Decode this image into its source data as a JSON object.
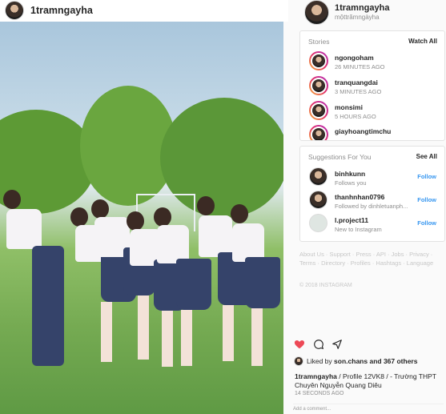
{
  "post": {
    "username": "1tramngayha",
    "actions": {
      "like_icon": "heart-icon",
      "comment_icon": "comment-icon",
      "share_icon": "share-icon",
      "like_color": "#ed4956"
    },
    "liked_by_prefix": "Liked by",
    "liked_by_user": "son.chans",
    "liked_by_suffix": "and 367 others",
    "caption_user": "1tramngayha",
    "caption_text": "/ Profile 12VK8 / - Trường THPT Chuyên Nguyễn Quang Diêu",
    "time": "14 SECONDS AGO",
    "add_comment_placeholder": "Add a comment..."
  },
  "profile": {
    "username": "1tramngayha",
    "fullname": "mộttrămngàyha"
  },
  "stories": {
    "title": "Stories",
    "watch_all": "Watch All",
    "items": [
      {
        "name": "ngongoham",
        "time": "26 MINUTES AGO"
      },
      {
        "name": "tranquangdai",
        "time": "3 MINUTES AGO"
      },
      {
        "name": "monsimi",
        "time": "5 HOURS AGO"
      },
      {
        "name": "giayhoangtimchu",
        "time": ""
      }
    ]
  },
  "suggestions": {
    "title": "Suggestions For You",
    "see_all": "See All",
    "items": [
      {
        "name": "binhkunn",
        "sub": "Follows you",
        "action": "Follow"
      },
      {
        "name": "thanhnhan0796",
        "sub": "Followed by dinhletuanph...",
        "action": "Follow"
      },
      {
        "name": "l.project11",
        "sub": "New to Instagram",
        "action": "Follow"
      }
    ]
  },
  "footer": {
    "links": "About Us · Support · Press · API · Jobs · Privacy · Terms · Directory · Profiles · Hashtags · Language",
    "copyright": "© 2018 INSTAGRAM"
  },
  "colors": {
    "link_blue": "#3897f0",
    "muted": "#8e8e8e",
    "text": "#262626"
  }
}
